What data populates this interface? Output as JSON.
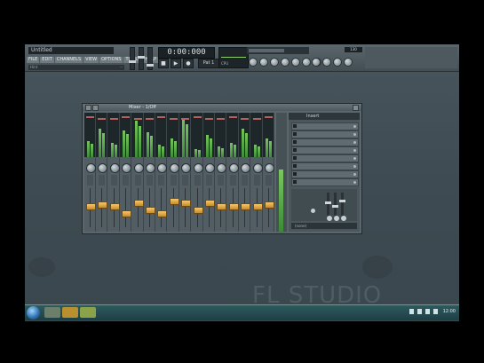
{
  "app": {
    "title": "Untitled"
  },
  "menu": [
    "FILE",
    "EDIT",
    "CHANNELS",
    "VIEW",
    "OPTIONS",
    "TOOLS",
    "HELP"
  ],
  "hint": {
    "left": "Hint",
    "right": "--"
  },
  "time_display": "0:00:000",
  "transport": [
    "■",
    "▶",
    "●"
  ],
  "pattern": "Pat 1",
  "cpu": "CPU",
  "tempo": "130",
  "mixer": {
    "title": "Mixer - 1/Off",
    "channels": [
      {
        "level": 0.4,
        "fader": 0.55
      },
      {
        "level": 0.7,
        "fader": 0.6
      },
      {
        "level": 0.35,
        "fader": 0.55
      },
      {
        "level": 0.65,
        "fader": 0.35
      },
      {
        "level": 0.9,
        "fader": 0.65
      },
      {
        "level": 0.6,
        "fader": 0.45
      },
      {
        "level": 0.3,
        "fader": 0.35
      },
      {
        "level": 0.45,
        "fader": 0.7
      },
      {
        "level": 0.95,
        "fader": 0.65
      },
      {
        "level": 0.2,
        "fader": 0.45
      },
      {
        "level": 0.55,
        "fader": 0.65
      },
      {
        "level": 0.25,
        "fader": 0.55
      },
      {
        "level": 0.35,
        "fader": 0.55
      },
      {
        "level": 0.7,
        "fader": 0.55
      },
      {
        "level": 0.3,
        "fader": 0.55
      },
      {
        "level": 0.45,
        "fader": 0.6
      }
    ],
    "fx_header": "Insert",
    "fx_slots": 8,
    "fx_out": "(none)"
  },
  "watermark": "FL STUDIO",
  "clock": "12:00",
  "colors": {
    "accent_fader": "#e8a84a",
    "meter": "#6fc257",
    "taskbar": "#244b50"
  }
}
